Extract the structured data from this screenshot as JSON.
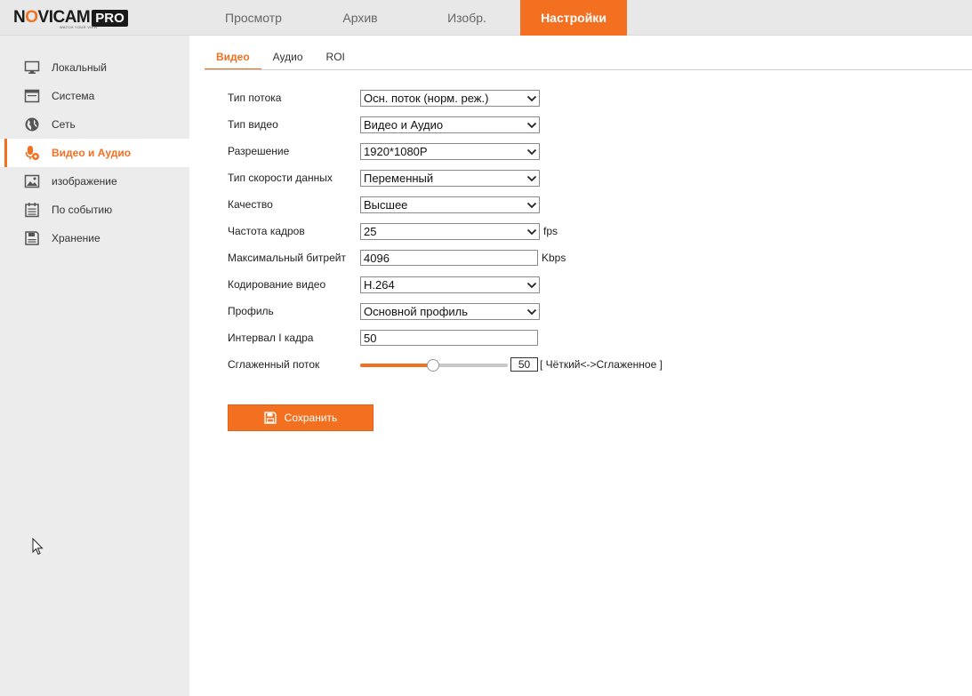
{
  "brand": {
    "name_pre": "N",
    "name_o": "O",
    "name_post": "VICAM",
    "pro": "PRO",
    "tagline": "WATCH YOUR VIEW"
  },
  "topnav": [
    {
      "label": "Просмотр",
      "active": false
    },
    {
      "label": "Архив",
      "active": false
    },
    {
      "label": "Изобр.",
      "active": false
    },
    {
      "label": "Настройки",
      "active": true
    }
  ],
  "sidebar": {
    "items": [
      {
        "label": "Локальный",
        "icon": "monitor-icon",
        "active": false
      },
      {
        "label": "Система",
        "icon": "system-window-icon",
        "active": false
      },
      {
        "label": "Сеть",
        "icon": "globe-icon",
        "active": false
      },
      {
        "label": "Видео и Аудио",
        "icon": "microphone-settings-icon",
        "active": true
      },
      {
        "label": "изображение",
        "icon": "image-icon",
        "active": false
      },
      {
        "label": "По событию",
        "icon": "calendar-list-icon",
        "active": false
      },
      {
        "label": "Хранение",
        "icon": "storage-icon",
        "active": false
      }
    ]
  },
  "tabs": [
    {
      "label": "Видео",
      "active": true
    },
    {
      "label": "Аудио",
      "active": false
    },
    {
      "label": "ROI",
      "active": false
    }
  ],
  "form": {
    "stream_type": {
      "label": "Тип потока",
      "value": "Осн. поток (норм. реж.)"
    },
    "video_type": {
      "label": "Тип видео",
      "value": "Видео и Аудио"
    },
    "resolution": {
      "label": "Разрешение",
      "value": "1920*1080P"
    },
    "bitrate_type": {
      "label": "Тип скорости данных",
      "value": "Переменный"
    },
    "quality": {
      "label": "Качество",
      "value": "Высшее"
    },
    "frame_rate": {
      "label": "Частота кадров",
      "value": "25",
      "unit": "fps"
    },
    "max_bitrate": {
      "label": "Максимальный битрейт",
      "value": "4096",
      "unit": "Kbps"
    },
    "encoding": {
      "label": "Кодирование видео",
      "value": "H.264"
    },
    "profile": {
      "label": "Профиль",
      "value": "Основной профиль"
    },
    "i_frame": {
      "label": "Интервал I кадра",
      "value": "50"
    },
    "smoothing": {
      "label": "Сглаженный поток",
      "value": "50",
      "min": 1,
      "max": 100,
      "hint": "[ Чёткий<->Сглаженное ]"
    }
  },
  "save_label": "Сохранить",
  "colors": {
    "accent": "#f37021",
    "sidebar_bg": "#ececec",
    "topbar_bg": "#e8e8e8"
  }
}
